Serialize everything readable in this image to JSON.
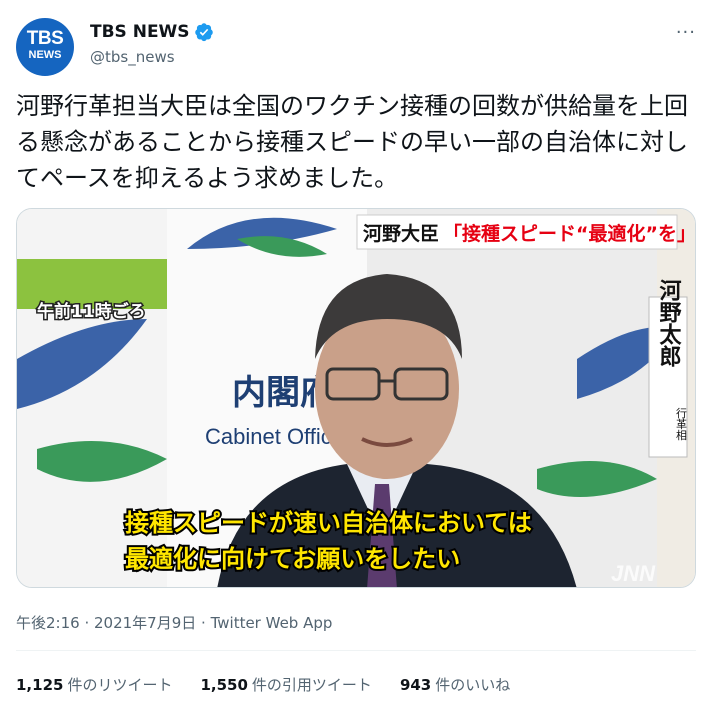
{
  "account": {
    "avatar_line1": "TBS",
    "avatar_line2": "NEWS",
    "display_name": "TBS NEWS",
    "handle": "@tbs_news",
    "verified_icon": "verified-badge-icon",
    "more_icon": "more-options-icon",
    "more_label": "···"
  },
  "tweet": {
    "text": "河野行革担当大臣は全国のワクチン接種の回数が供給量を上回る懸念があることから接種スピードの早い一部の自治体に対してペースを抑えるよう求めました。"
  },
  "media": {
    "caption_top_name": "河野大臣",
    "caption_top_quote": "「接種スピード“最適化”を」",
    "time_label": "午前11時ごろ",
    "side_name": "河野太郎",
    "side_title": "行革相",
    "backdrop_jp": "内閣府",
    "backdrop_en": "Cabinet Office",
    "subtitle_line1": "接種スピードが速い自治体においては",
    "subtitle_line2": "最適化に向けてお願いをしたい",
    "watermark": "JNN"
  },
  "meta": {
    "time": "午後2:16",
    "date": "2021年7月9日",
    "client": "Twitter Web App",
    "sep": " · "
  },
  "stats": {
    "retweets_count": "1,125",
    "retweets_label": "件のリツイート",
    "quotes_count": "1,550",
    "quotes_label": "件の引用ツイート",
    "likes_count": "943",
    "likes_label": "件のいいね"
  },
  "colors": {
    "accent": "#1d9bf0",
    "avatar_bg": "#1565c0",
    "subtitle_yellow": "#ffe600",
    "caption_red": "#e60012"
  }
}
